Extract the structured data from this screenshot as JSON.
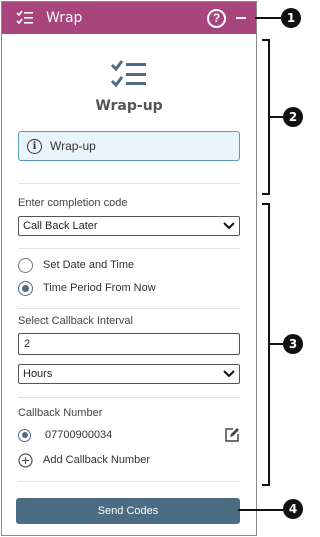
{
  "titlebar": {
    "title": "Wrap",
    "help_icon": "question-circle-icon",
    "minimize_icon": "minimize-icon",
    "color": "#a8457d"
  },
  "hero": {
    "icon": "checklist-icon",
    "title": "Wrap-up"
  },
  "info_box": {
    "text": "Wrap-up",
    "icon": "info-icon"
  },
  "completion": {
    "label": "Enter completion code",
    "selected": "Call Back Later"
  },
  "schedule": {
    "options": [
      {
        "label": "Set Date and Time",
        "checked": false
      },
      {
        "label": "Time Period From Now",
        "checked": true
      }
    ]
  },
  "interval": {
    "label": "Select Callback Interval",
    "value": "2",
    "unit": "Hours"
  },
  "callback": {
    "label": "Callback Number",
    "number": "07700900034",
    "add_label": "Add Callback Number"
  },
  "send_button": {
    "label": "Send Codes",
    "color": "#4b6c82"
  },
  "callouts": [
    "1",
    "2",
    "3",
    "4"
  ]
}
